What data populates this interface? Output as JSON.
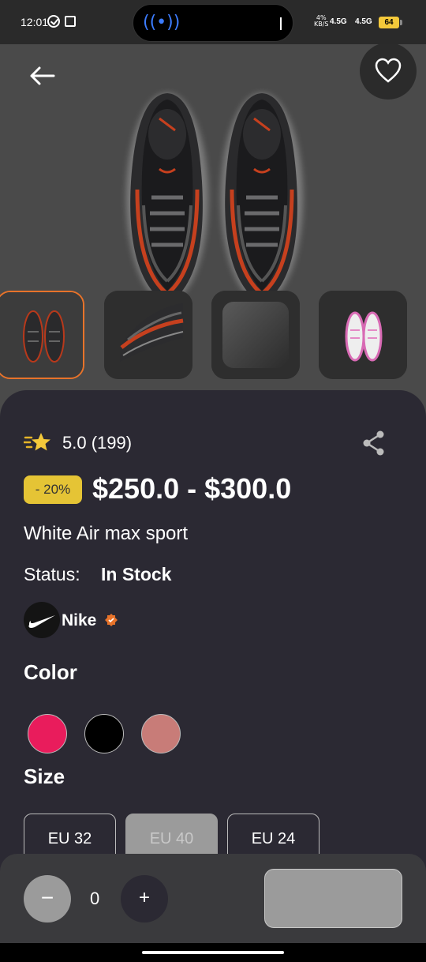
{
  "status_bar": {
    "time": "12:01",
    "net_speed_top": "4%",
    "net_speed_bottom": "KB/S",
    "signal1": "4.5G",
    "signal2": "4.5G",
    "battery": "64"
  },
  "hero": {
    "back_icon": "arrow-left-icon",
    "favorite_icon": "heart-icon",
    "thumbnails": [
      "thumbnail-pair-black-red",
      "thumbnail-closeup-red",
      "thumbnail-gray-surface",
      "thumbnail-pink-pair"
    ]
  },
  "product": {
    "rating": "5.0 (199)",
    "discount": "- 20%",
    "price_range": "$250.0 - $300.0",
    "name": "White Air max sport",
    "status_label": "Status:",
    "status_value": "In Stock",
    "brand": "Nike",
    "color_title": "Color",
    "colors": [
      "#e91c5c",
      "#000000",
      "#c87c78"
    ],
    "size_title": "Size",
    "sizes": [
      "EU 32",
      "EU 40",
      "EU 24"
    ],
    "selected_size": "EU 40"
  },
  "bottom_bar": {
    "minus": "−",
    "quantity": "0",
    "plus": "+"
  },
  "colors": {
    "accent": "#e8732a",
    "discount_badge": "#e5c435",
    "sheet_bg": "#2b2933"
  }
}
